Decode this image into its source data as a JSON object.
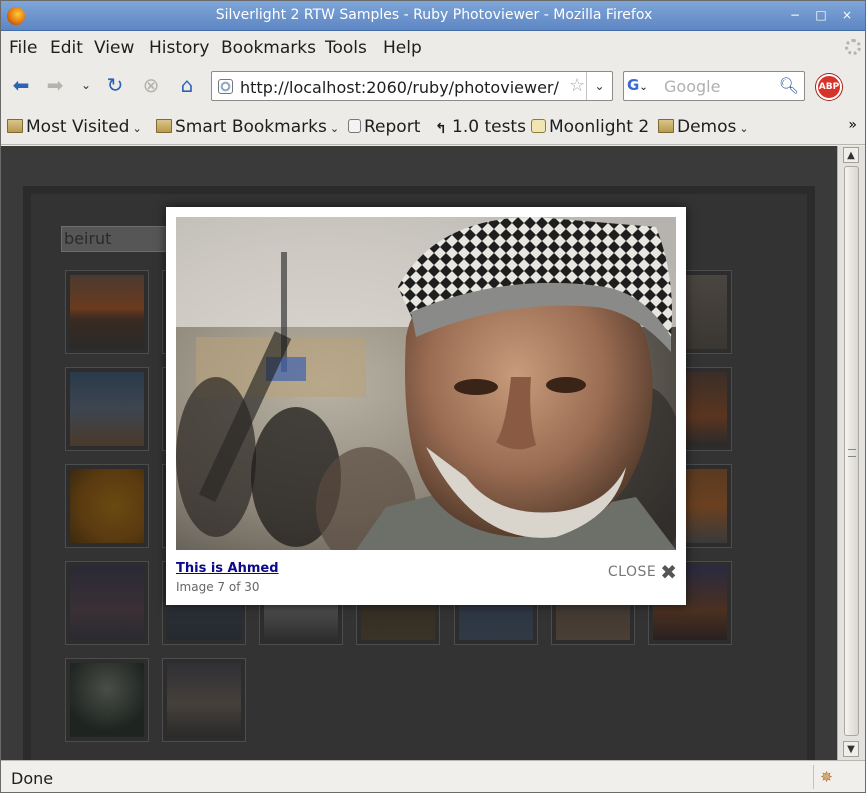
{
  "window": {
    "title": "Silverlight 2 RTW Samples - Ruby Photoviewer - Mozilla Firefox",
    "controls": [
      "−",
      "□",
      "×"
    ]
  },
  "menu": [
    "File",
    "Edit",
    "View",
    "History",
    "Bookmarks",
    "Tools",
    "Help"
  ],
  "nav": {
    "url": "http://localhost:2060/ruby/photoviewer/",
    "search_placeholder": "Google",
    "search_engine": "G",
    "adblock_label": "ABP"
  },
  "bookmarks": [
    {
      "label": "Most Visited",
      "icon": "most-visited-icon",
      "menu": true
    },
    {
      "label": "Smart Bookmarks",
      "icon": "folder-icon",
      "menu": true
    },
    {
      "label": "Report",
      "icon": "page-icon",
      "menu": false
    },
    {
      "label": "1.0 tests",
      "icon": "tests-icon",
      "menu": false
    },
    {
      "label": "Moonlight 2",
      "icon": "moonlight-icon",
      "menu": false
    },
    {
      "label": "Demos",
      "icon": "folder-icon",
      "menu": true
    }
  ],
  "app": {
    "search_value": "beirut"
  },
  "lightbox": {
    "caption": "This is Ahmed",
    "counter": "Image 7 of 30",
    "close_label": "CLOSE"
  },
  "status": {
    "text": "Done"
  },
  "colors": {
    "titlebar": "#6b93cc",
    "overlay": "#3a3a3a",
    "caption_link": "#0a0a8a",
    "abp_red": "#d7332b"
  }
}
